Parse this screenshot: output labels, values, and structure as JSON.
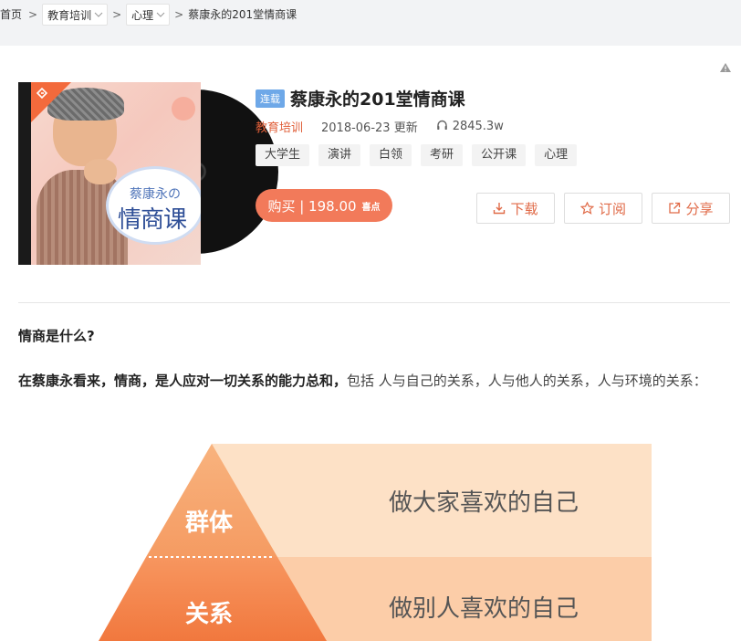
{
  "breadcrumb": {
    "home": "首页",
    "sep": ">",
    "cat1": "教育培训",
    "cat2": "心理",
    "current": "蔡康永的201堂情商课"
  },
  "cover": {
    "title_small": "蔡康永の",
    "title_big": "情商课"
  },
  "album": {
    "badge": "连载",
    "title": "蔡康永的201堂情商课",
    "category": "教育培训",
    "updated": "2018-06-23 更新",
    "plays": "2845.3w",
    "tags": [
      "大学生",
      "演讲",
      "白领",
      "考研",
      "公开课",
      "心理"
    ]
  },
  "buy": {
    "label": "购买 | 198.00",
    "unit": "喜点"
  },
  "actions": {
    "download": "下载",
    "subscribe": "订阅",
    "share": "分享"
  },
  "content": {
    "question": "情商是什么?",
    "para_bold": "在蔡康永看来，情商，是人应对一切关系的能力总和，",
    "para_rest": "包括 人与自己的关系，人与他人的关系，人与环境的关系："
  },
  "illustration": {
    "level1_label": "群体",
    "level1_text": "做大家喜欢的自己",
    "level2_label": "关系",
    "level2_text": "做别人喜欢的自己"
  },
  "colors": {
    "accent": "#e05f39",
    "buy_bg": "#f27a5a",
    "badge_bg": "#6ea8e8"
  }
}
